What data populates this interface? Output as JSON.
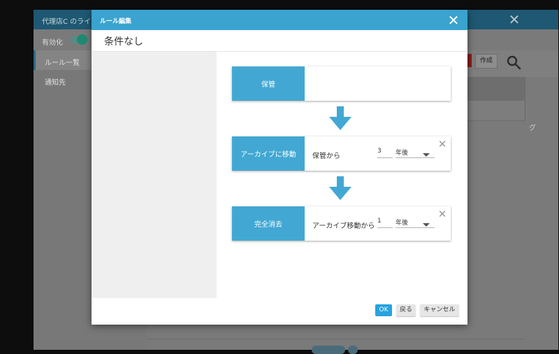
{
  "background": {
    "window_title": "代理店C のライフサ",
    "toggle_label": "有効化",
    "sidebar": {
      "items": [
        {
          "label": "ルール一覧"
        },
        {
          "label": "通知先"
        }
      ]
    },
    "create_label": "作成",
    "right_truncated_text": "グ"
  },
  "modal": {
    "title": "ルール編集",
    "subheader": "条件なし",
    "steps": [
      {
        "label": "保管"
      },
      {
        "label": "アーカイブに移動",
        "from_text": "保管から",
        "number": "3",
        "unit": "年後"
      },
      {
        "label": "完全消去",
        "from_text": "アーカイブ移動から",
        "number": "1",
        "unit": "年後"
      }
    ],
    "buttons": {
      "ok": "OK",
      "back": "戻る",
      "cancel": "キャンセル"
    }
  },
  "icons": {
    "close": "close-icon",
    "search": "search-icon",
    "arrow": "arrow-down-icon",
    "dropdown": "chevron-down-icon",
    "remove": "remove-step-icon"
  },
  "colors": {
    "header_accent": "#3aa3cf",
    "step_label": "#42a8d3",
    "ok_button": "#26a3e0",
    "background_header": "#1e5872"
  }
}
